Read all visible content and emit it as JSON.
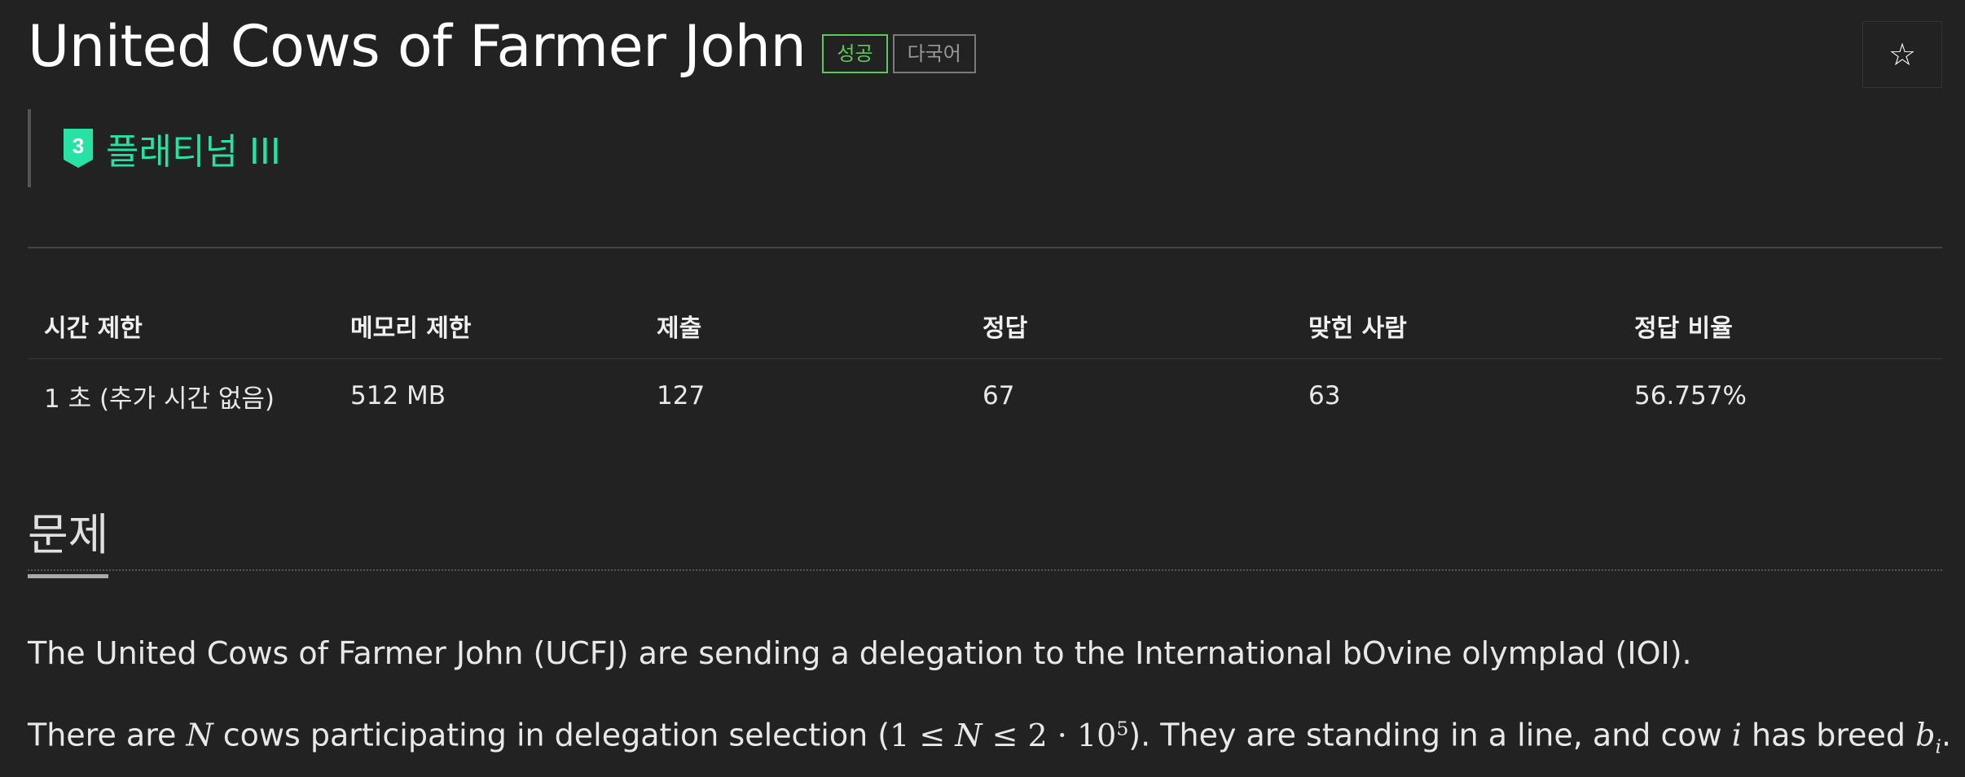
{
  "problem": {
    "title": "United Cows of Farmer John",
    "badges": {
      "success": "성공",
      "multilang": "다국어"
    },
    "favorite_icon": "star-icon",
    "tier": {
      "label": "플래티넘 III",
      "level": "3",
      "color": "#27e2a4"
    }
  },
  "stats": {
    "headers": [
      "시간 제한",
      "메모리 제한",
      "제출",
      "정답",
      "맞힌 사람",
      "정답 비율"
    ],
    "values": [
      "1 초 (추가 시간 없음)",
      "512 MB",
      "127",
      "67",
      "63",
      "56.757%"
    ]
  },
  "section": {
    "title": "문제"
  },
  "statement": {
    "p1": "The United Cows of Farmer John (UCFJ) are sending a delegation to the International bOvine olympIad (IOI).",
    "p2": {
      "pre": "There are ",
      "var_n": "N",
      "mid": " cows participating in delegation selection (",
      "constraint_lhs": "1 ≤ ",
      "constraint_n": "N",
      "constraint_rhs": " ≤ 2 · 10",
      "constraint_exp": "5",
      "after": "). They are standing in a line, and cow ",
      "var_i": "i",
      "breed": " has breed ",
      "var_b": "b",
      "var_sub": "i",
      "end": "."
    }
  }
}
